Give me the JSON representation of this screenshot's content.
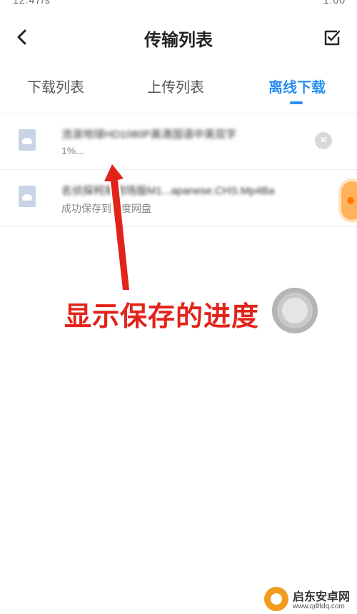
{
  "status_bar": {
    "left_text": "12:47/s",
    "right_text": "1:00"
  },
  "header": {
    "title": "传输列表"
  },
  "tabs": [
    {
      "label": "下载列表",
      "active": false
    },
    {
      "label": "上传列表",
      "active": false
    },
    {
      "label": "离线下载",
      "active": true
    }
  ],
  "files": [
    {
      "name": "流浪地球HD1080P高清国语中英双字",
      "status": "1%..."
    },
    {
      "name": "名侦探柯南剧场版M1...apanese.CHS.Mp4Ba",
      "status": "成功保存到百度网盘"
    }
  ],
  "annotation": {
    "text": "显示保存的进度"
  },
  "watermark": {
    "name": "启东安卓网",
    "url": "www.qdltdq.com"
  },
  "colors": {
    "accent": "#2a8ff0",
    "annotation": "#e2231a"
  }
}
